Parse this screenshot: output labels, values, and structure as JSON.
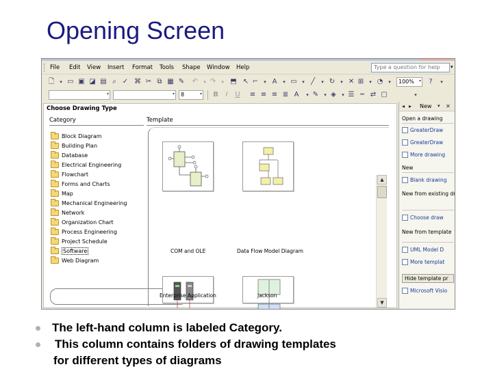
{
  "slide": {
    "title": "Opening Screen",
    "bullets": [
      "The left-hand column is labeled Category.",
      "This column contains folders of drawing templates",
      "for different types of diagrams"
    ]
  },
  "menubar": {
    "items": [
      "File",
      "Edit",
      "View",
      "Insert",
      "Format",
      "Tools",
      "Shape",
      "Window",
      "Help"
    ],
    "help_placeholder": "Type a question for help"
  },
  "toolbar": {
    "zoom": "100%",
    "font_size": "8"
  },
  "choose_drawing": {
    "panel_title": "Choose Drawing Type",
    "category_header": "Category",
    "template_header": "Template",
    "categories": [
      "Block Diagram",
      "Building Plan",
      "Database",
      "Electrical Engineering",
      "Flowchart",
      "Forms and Charts",
      "Map",
      "Mechanical Engineering",
      "Network",
      "Organization Chart",
      "Process Engineering",
      "Project Schedule",
      "Software",
      "Web Diagram"
    ],
    "selected_category": "Software",
    "templates": [
      "COM and OLE",
      "Data Flow Model Diagram",
      "Enterprise Application",
      "Jackson"
    ]
  },
  "task_pane": {
    "title": "New",
    "open_heading": "Open a drawing",
    "open_links": [
      "GreaterDraw",
      "GreaterDraw",
      "More drawing"
    ],
    "new_heading": "New",
    "new_links": [
      "Blank drawing"
    ],
    "existing_heading": "New from existing drawing",
    "existing_links": [
      "Choose draw"
    ],
    "template_heading": "New from template",
    "template_links": [
      "UML Model D",
      "More templat"
    ],
    "hide_button": "Hide template pr",
    "bottom_link": "Microsoft Visio"
  },
  "colors": {
    "title": "#1a1a80",
    "link": "#1a3a9a",
    "chrome": "#ece9d8"
  }
}
